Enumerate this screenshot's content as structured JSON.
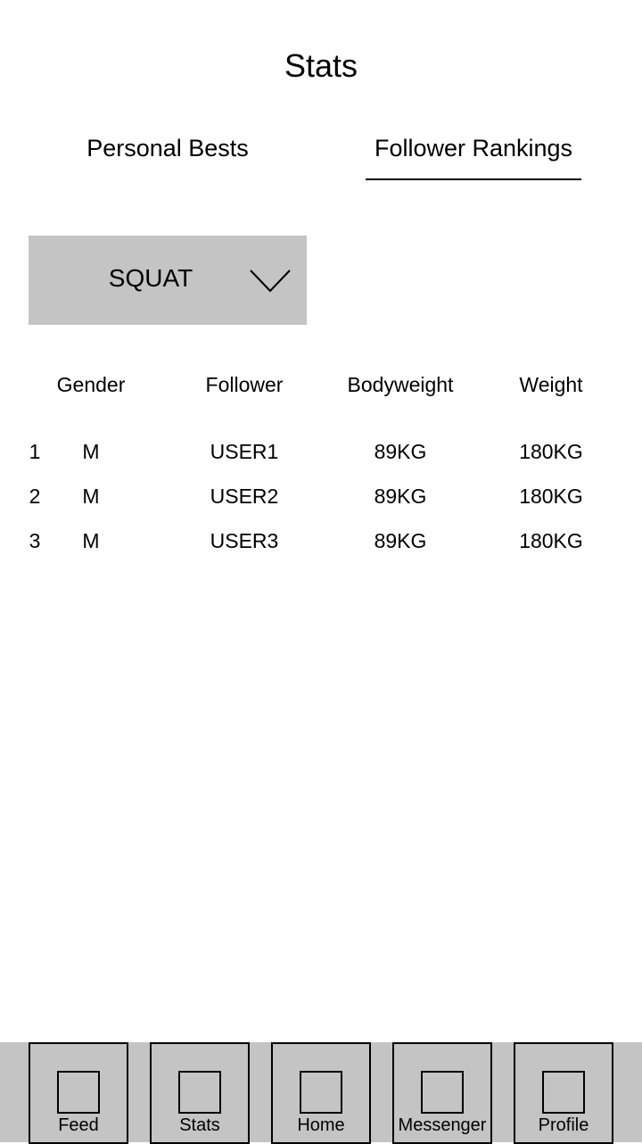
{
  "header": {
    "title": "Stats"
  },
  "tabs": [
    {
      "label": "Personal Bests",
      "active": false
    },
    {
      "label": "Follower Rankings",
      "active": true
    }
  ],
  "exercise_select": {
    "value": "SQUAT",
    "icon": "chevron-down-icon"
  },
  "table": {
    "columns": [
      "Gender",
      "Follower",
      "Bodyweight",
      "Weight"
    ],
    "rows": [
      {
        "rank": "1",
        "gender": "M",
        "follower": "USER1",
        "bodyweight": "89KG",
        "weight": "180KG"
      },
      {
        "rank": "2",
        "gender": "M",
        "follower": "USER2",
        "bodyweight": "89KG",
        "weight": "180KG"
      },
      {
        "rank": "3",
        "gender": "M",
        "follower": "USER3",
        "bodyweight": "89KG",
        "weight": "180KG"
      }
    ]
  },
  "bottom_nav": {
    "items": [
      {
        "label": "Feed",
        "icon": "square-icon"
      },
      {
        "label": "Stats",
        "icon": "square-icon"
      },
      {
        "label": "Home",
        "icon": "square-icon"
      },
      {
        "label": "Messenger",
        "icon": "square-icon"
      },
      {
        "label": "Profile",
        "icon": "square-icon"
      }
    ]
  },
  "colors": {
    "background": "#ffffff",
    "panel_gray": "#c4c4c4",
    "text": "#000000"
  }
}
